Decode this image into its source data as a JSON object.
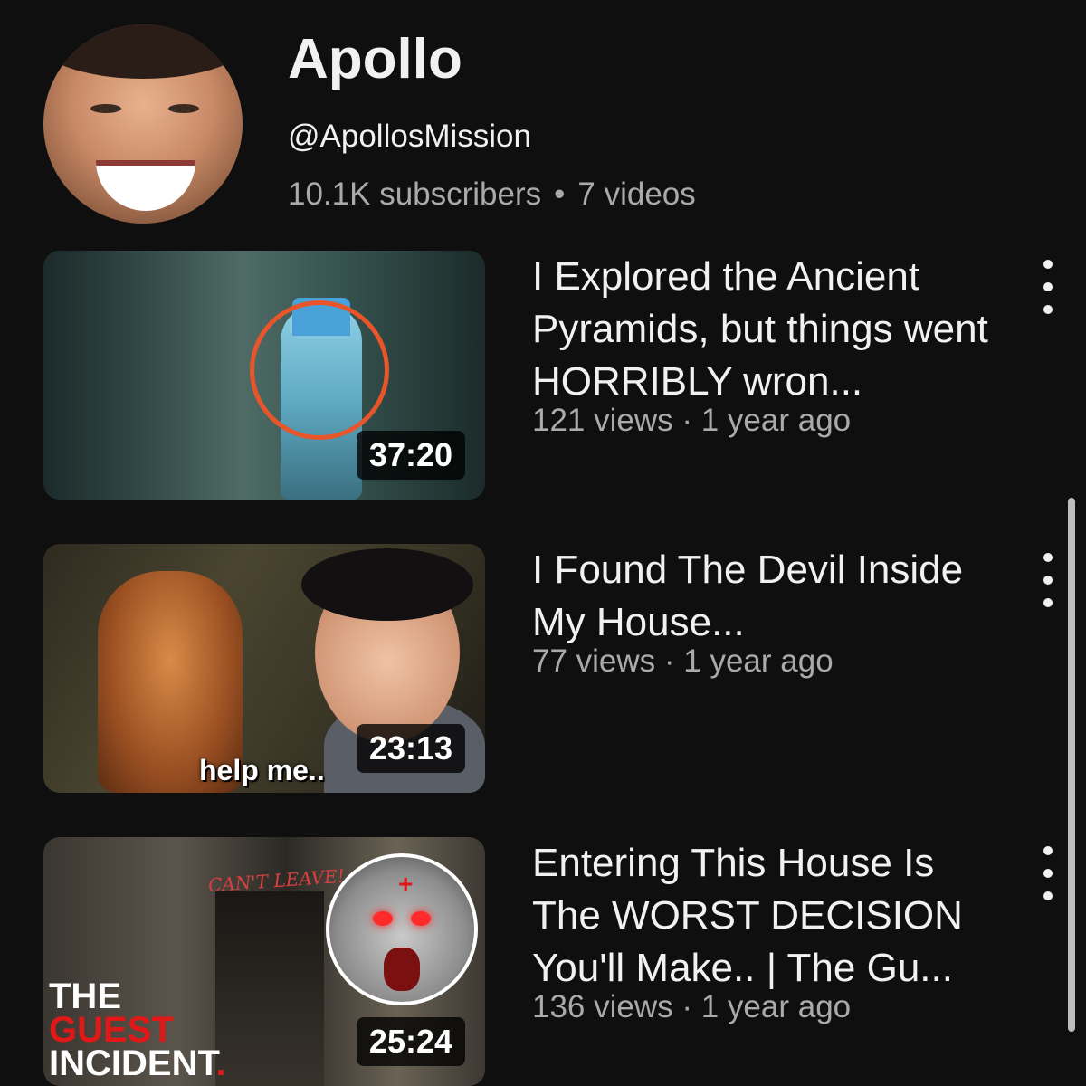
{
  "channel": {
    "name": "Apollo",
    "handle": "@ApollosMission",
    "subscribers": "10.1K subscribers",
    "separator": "•",
    "video_count": "7 videos"
  },
  "videos": [
    {
      "title": "I Explored the Ancient Pyramids, but things went HORRIBLY wron...",
      "stats": "121 views · 1 year ago",
      "duration": "37:20"
    },
    {
      "title": "I Found The Devil Inside My House...",
      "stats": "77 views · 1 year ago",
      "duration": "23:13",
      "thumb_caption": "help me.."
    },
    {
      "title": "Entering This House Is The WORST DECISION You'll Make.. | The Gu...",
      "stats": "136 views · 1 year ago",
      "duration": "25:24",
      "thumb_sign": "CAN'T LEAVE!",
      "thumb_brand": [
        "THE",
        "GUEST",
        "INCIDENT",
        "."
      ]
    }
  ],
  "icons": {
    "more": "more-vertical-icon"
  }
}
